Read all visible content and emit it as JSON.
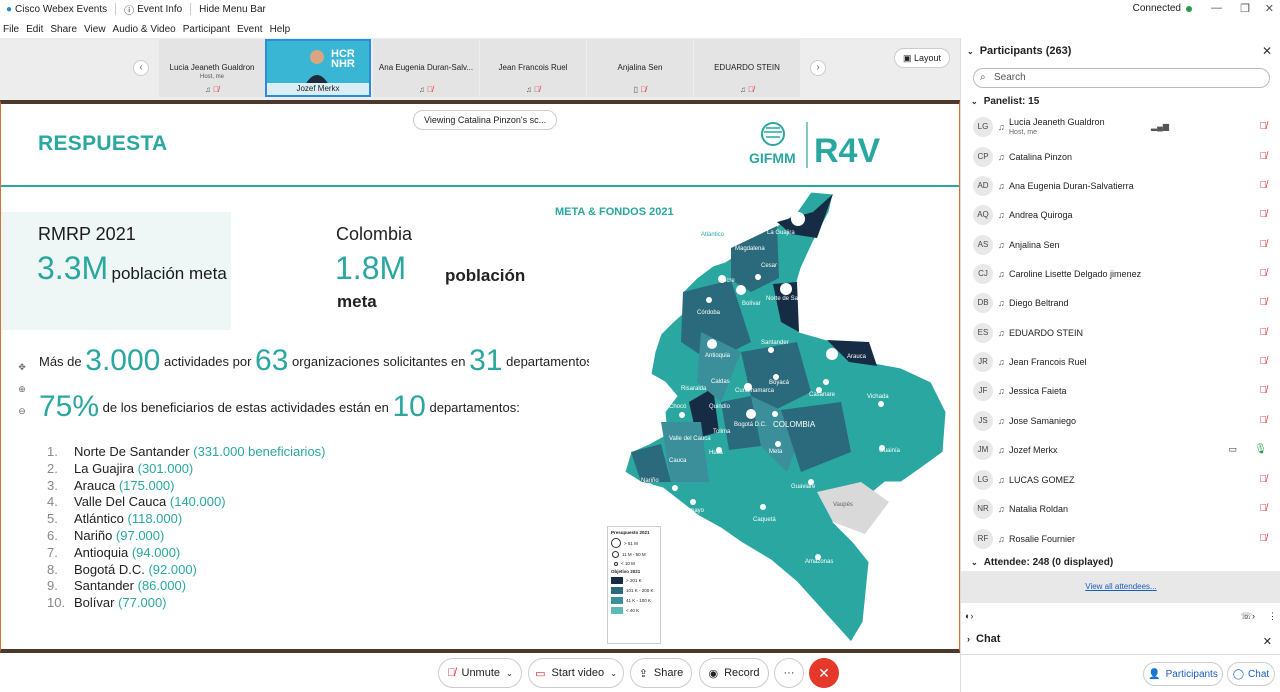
{
  "titlebar": {
    "app_title": "Cisco Webex Events",
    "event_info": "Event Info",
    "hide_menu": "Hide Menu Bar",
    "status": "Connected"
  },
  "menu": [
    "File",
    "Edit",
    "Share",
    "View",
    "Audio & Video",
    "Participant",
    "Event",
    "Help"
  ],
  "video_strip": {
    "tiles": [
      {
        "name": "Lucia Jeaneth Gualdron",
        "sub": "Host, me"
      },
      {
        "name": "Jozef Merkx",
        "video": true
      },
      {
        "name": "Ana Eugenia Duran-Salv..."
      },
      {
        "name": "Jean Francois Ruel"
      },
      {
        "name": "Anjalina Sen"
      },
      {
        "name": "EDUARDO STEIN"
      }
    ],
    "layout_label": "Layout"
  },
  "share": {
    "viewing": "Viewing Catalina Pinzon's sc...",
    "slide_title": "RESPUESTA",
    "logo_left": "GIFMM",
    "logo_right": "R4V",
    "rmrp_title": "RMRP 2021",
    "rmrp_num": "3.3M",
    "rmrp_label": "población meta",
    "col_title": "Colombia",
    "col_num": "1.8M",
    "col_label1": "población",
    "col_label2": "meta",
    "line1": {
      "pre": "Más de",
      "n1": "3.000",
      "mid1": "actividades por",
      "n2": "63",
      "mid2": "organizaciones solicitantes en",
      "n3": "31",
      "post": "departamentos"
    },
    "line2": {
      "n1": "75%",
      "mid": "de los beneficiarios de estas actividades están en",
      "n2": "10",
      "post": "departamentos:"
    },
    "list": [
      {
        "n": "1.",
        "name": "Norte De Santander",
        "val": "(331.000 beneficiarios)"
      },
      {
        "n": "2.",
        "name": "La Guajira",
        "val": "(301.000)"
      },
      {
        "n": "3.",
        "name": "Arauca",
        "val": "(175.000)"
      },
      {
        "n": "4.",
        "name": "Valle Del Cauca",
        "val": "(140.000)"
      },
      {
        "n": "5.",
        "name": "Atlántico",
        "val": "(118.000)"
      },
      {
        "n": "6.",
        "name": "Nariño",
        "val": "(97.000)"
      },
      {
        "n": "7.",
        "name": "Antioquia",
        "val": "(94.000)"
      },
      {
        "n": "8.",
        "name": "Bogotá D.C.",
        "val": "(92.000)"
      },
      {
        "n": "9.",
        "name": "Santander",
        "val": "(86.000)"
      },
      {
        "n": "10.",
        "name": "Bolívar",
        "val": "(77.000)"
      }
    ],
    "map_title": "META & FONDOS 2021",
    "map_labels": [
      "Atlántico",
      "La Guajira",
      "Magdalena",
      "Cesar",
      "Sucre",
      "Bolívar",
      "Norte de Santander",
      "Córdoba",
      "Antioquia",
      "Santander",
      "Arauca",
      "Chocó",
      "Caldas",
      "Risaralda",
      "Boyacá",
      "Casanare",
      "Vichada",
      "Cundinamarca",
      "Quindío",
      "Bogotá D.C.",
      "Valle del Cauca",
      "Tolima",
      "COLOMBIA",
      "Huila",
      "Meta",
      "Guainía",
      "Cauca",
      "Nariño",
      "Guaviare",
      "Vaupés",
      "Putumayo",
      "Caquetá",
      "Amazonas"
    ],
    "legend": {
      "t1": "Presupuesto 2021",
      "c1": "> 51 M",
      "c2": "11 M - 50 M",
      "c3": "< 10 M",
      "t2": "Objetivo 2021",
      "s1": "> 201 K",
      "s2": "101 K - 200 K",
      "s3": "41 K - 100 K",
      "s4": "< 40 K"
    }
  },
  "bottombar": {
    "unmute": "Unmute",
    "start_video": "Start video",
    "share": "Share",
    "record": "Record",
    "more": "···"
  },
  "panel": {
    "title": "Participants (263)",
    "search_placeholder": "Search",
    "panelist_header": "Panelist: 15",
    "participants": [
      {
        "initials": "LG",
        "name": "Lucia Jeaneth Gualdron",
        "sub": "Host, me"
      },
      {
        "initials": "CP",
        "name": "Catalina Pinzon"
      },
      {
        "initials": "AD",
        "name": "Ana Eugenia Duran-Salvatierra"
      },
      {
        "initials": "AQ",
        "name": "Andrea Quiroga"
      },
      {
        "initials": "AS",
        "name": "Anjalina Sen"
      },
      {
        "initials": "CJ",
        "name": "Caroline Lisette Delgado jimenez"
      },
      {
        "initials": "DB",
        "name": "Diego Beltrand"
      },
      {
        "initials": "ES",
        "name": "EDUARDO STEIN"
      },
      {
        "initials": "JR",
        "name": "Jean Francois Ruel"
      },
      {
        "initials": "JF",
        "name": "Jessica Faieta"
      },
      {
        "initials": "JS",
        "name": "Jose Samaniego"
      },
      {
        "initials": "JM",
        "name": "Jozef Merkx"
      },
      {
        "initials": "LG",
        "name": "LUCAS GOMEZ"
      },
      {
        "initials": "NR",
        "name": "Natalia Roldan"
      },
      {
        "initials": "RF",
        "name": "Rosalie Fournier"
      }
    ],
    "attendee_header": "Attendee: 248 (0 displayed)",
    "view_all": "View all attendees...",
    "chat": "Chat",
    "btn_participants": "Participants",
    "btn_chat": "Chat"
  },
  "colors": {
    "teal": "#2aa7a0",
    "navy": "#152c44",
    "dark_teal": "#2b6a7c",
    "mid_teal": "#3a8f9a",
    "light_teal": "#5bbab4",
    "mute_red": "#d22233",
    "end_red": "#e5382a"
  }
}
